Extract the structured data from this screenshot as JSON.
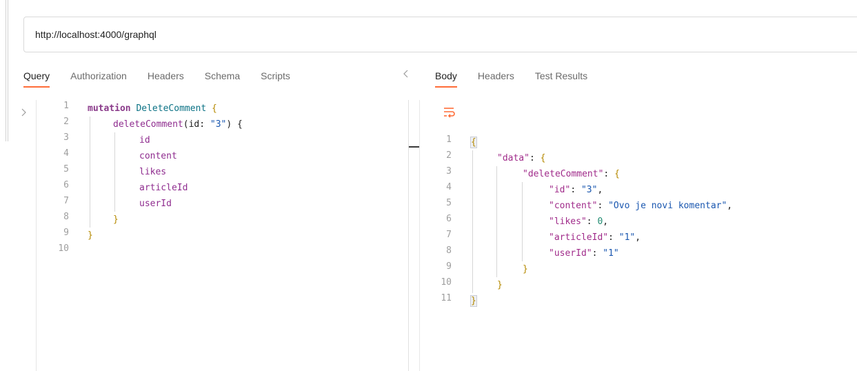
{
  "url": {
    "value": "http://localhost:4000/graphql"
  },
  "query_tabs": [
    "Query",
    "Authorization",
    "Headers",
    "Schema",
    "Scripts"
  ],
  "response_tabs": [
    "Body",
    "Headers",
    "Test Results"
  ],
  "query_editor": {
    "line_numbers": [
      "1",
      "2",
      "3",
      "4",
      "5",
      "6",
      "7",
      "8",
      "9",
      "10"
    ],
    "lines": [
      {
        "keyword": "mutation",
        "name": "DeleteComment",
        "brace": "{"
      },
      {
        "field": "deleteComment",
        "args": "(id: ",
        "arg_value": "\"3\"",
        "close": ") {"
      },
      {
        "field": "id"
      },
      {
        "field": "content"
      },
      {
        "field": "likes"
      },
      {
        "field": "articleId"
      },
      {
        "field": "userId"
      },
      {
        "brace": "}"
      },
      {
        "brace": "}"
      },
      {}
    ]
  },
  "response_editor": {
    "line_numbers": [
      "1",
      "2",
      "3",
      "4",
      "5",
      "6",
      "7",
      "8",
      "9",
      "10",
      "11"
    ],
    "data_key": "\"data\"",
    "delete_key": "\"deleteComment\"",
    "fields": [
      {
        "key": "\"id\"",
        "value": "\"3\"",
        "type": "string",
        "trail": ","
      },
      {
        "key": "\"content\"",
        "value": "\"Ovo je novi komentar\"",
        "type": "string",
        "trail": ","
      },
      {
        "key": "\"likes\"",
        "value": "0",
        "type": "number",
        "trail": ","
      },
      {
        "key": "\"articleId\"",
        "value": "\"1\"",
        "type": "string",
        "trail": ","
      },
      {
        "key": "\"userId\"",
        "value": "\"1\"",
        "type": "string",
        "trail": ""
      }
    ],
    "open_brace": "{",
    "close_brace": "}",
    "colon": ": "
  },
  "colors": {
    "accent": "#ff6c37"
  }
}
